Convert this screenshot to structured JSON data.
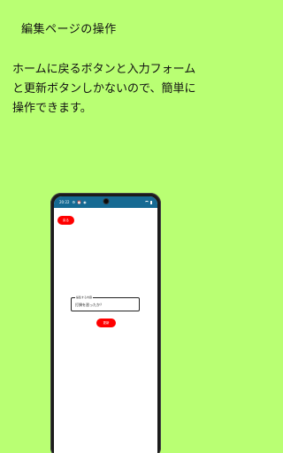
{
  "page": {
    "headline": "編集ページの操作",
    "description": "ホームに戻るボタンと入力フォームと更新ボタンしかないので、簡単に操作できます。"
  },
  "device": {
    "status_bar": {
      "time": "20:22",
      "left_icons": [
        "gear-icon",
        "alarm-icon",
        "notification-icon"
      ],
      "right_icons": [
        "wifi-icon",
        "battery-icon"
      ],
      "color": "#166a93"
    },
    "back_button": {
      "label": "戻る",
      "color": "#ff0000"
    },
    "form": {
      "field_label": "編集する内容",
      "field_value": "打撲を習ったか？"
    },
    "update_button": {
      "label": "更新",
      "color": "#ff0000"
    }
  },
  "colors": {
    "background": "#b9ff73",
    "accent": "#ff0000"
  }
}
